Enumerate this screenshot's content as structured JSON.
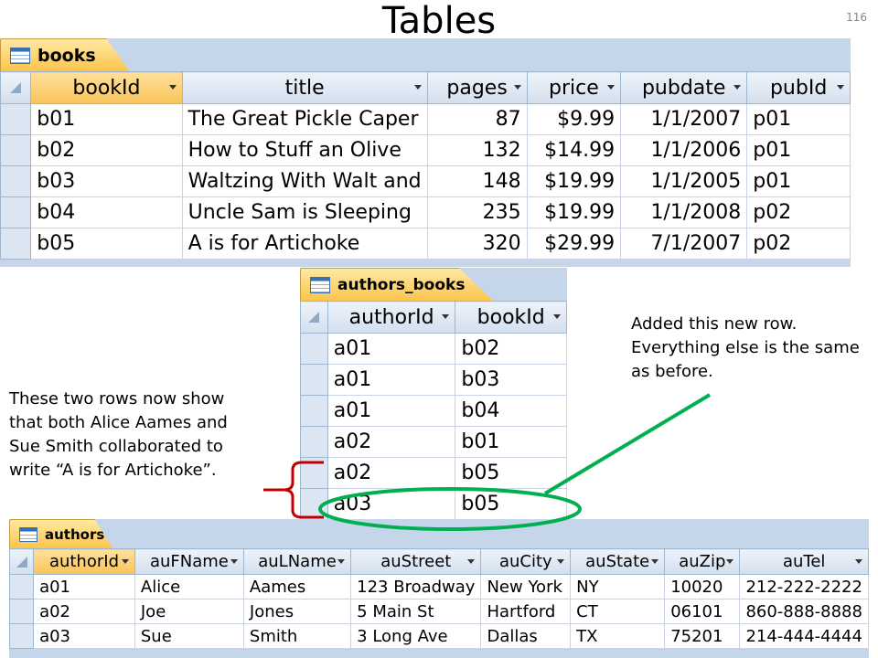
{
  "slide": {
    "title": "Tables",
    "number": "116"
  },
  "books": {
    "tab": "books",
    "columns": [
      "bookId",
      "title",
      "pages",
      "price",
      "pubdate",
      "pubId"
    ],
    "rows": [
      [
        "b01",
        "The Great Pickle Caper",
        "87",
        "$9.99",
        "1/1/2007",
        "p01"
      ],
      [
        "b02",
        "How to Stuff an Olive",
        "132",
        "$14.99",
        "1/1/2006",
        "p01"
      ],
      [
        "b03",
        "Waltzing With Walt and",
        "148",
        "$19.99",
        "1/1/2005",
        "p01"
      ],
      [
        "b04",
        "Uncle Sam is Sleeping",
        "235",
        "$19.99",
        "1/1/2008",
        "p02"
      ],
      [
        "b05",
        "A is for Artichoke",
        "320",
        "$29.99",
        "7/1/2007",
        "p02"
      ]
    ]
  },
  "authors_books": {
    "tab": "authors_books",
    "columns": [
      "authorId",
      "bookId"
    ],
    "rows": [
      [
        "a01",
        "b02"
      ],
      [
        "a01",
        "b03"
      ],
      [
        "a01",
        "b04"
      ],
      [
        "a02",
        "b01"
      ],
      [
        "a02",
        "b05"
      ],
      [
        "a03",
        "b05"
      ]
    ]
  },
  "authors": {
    "tab": "authors",
    "columns": [
      "authorId",
      "auFName",
      "auLName",
      "auStreet",
      "auCity",
      "auState",
      "auZip",
      "auTel"
    ],
    "rows": [
      [
        "a01",
        "Alice",
        "Aames",
        "123 Broadway",
        "New York",
        "NY",
        "10020",
        "212-222-2222"
      ],
      [
        "a02",
        "Joe",
        "Jones",
        "5 Main St",
        "Hartford",
        "CT",
        "06101",
        "860-888-8888"
      ],
      [
        "a03",
        "Sue",
        "Smith",
        "3 Long Ave",
        "Dallas",
        "TX",
        "75201",
        "214-444-4444"
      ]
    ]
  },
  "notes": {
    "left": "These two rows now show that both Alice Aames and Sue Smith collaborated to write “A is for Artichoke”.",
    "right": "Added this new row. Everything else is the same as before."
  },
  "colors": {
    "bracket": "#c00000",
    "highlight": "#00b050",
    "tab": "#fbc349",
    "header_selected": "#f8c35a"
  }
}
